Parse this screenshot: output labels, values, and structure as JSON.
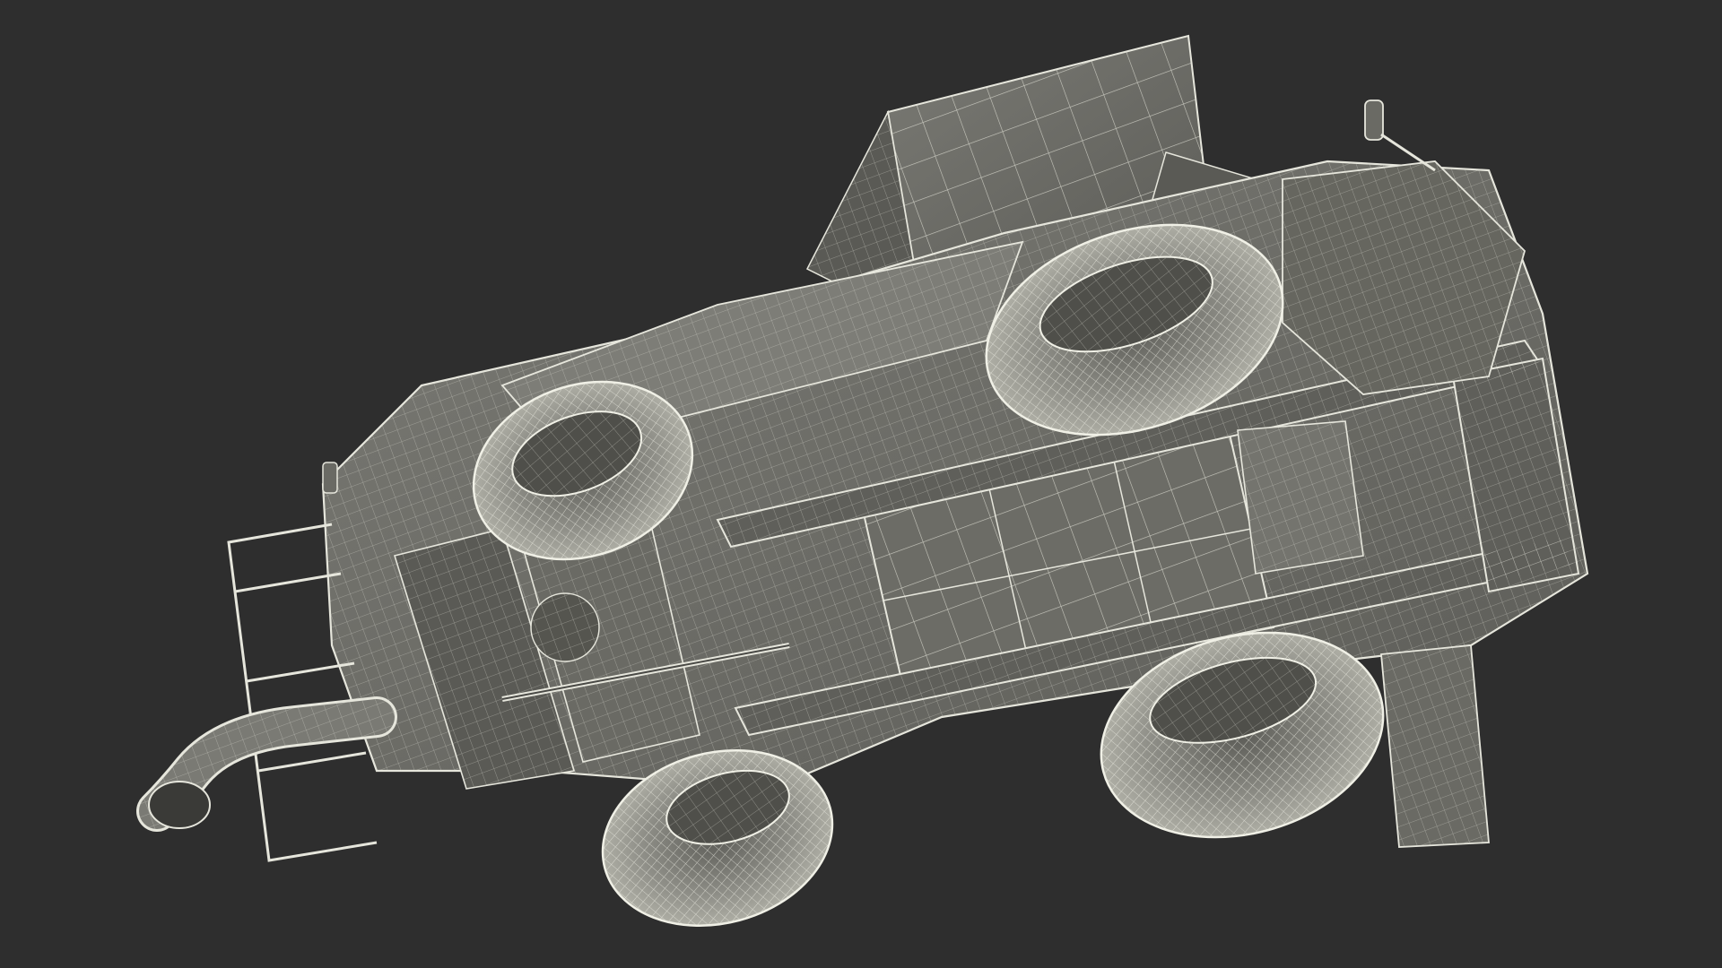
{
  "scene": {
    "subject": "wireframe-telehandler-underside",
    "colors": {
      "background": "#2e2e2e",
      "panel_fill": "#6f6f6a",
      "panel_light": "#86867f",
      "panel_dark": "#4a4a46",
      "wire": "#e6e6dc",
      "wire_soft": "#bdbdb2",
      "shadow": "#1f1f1f",
      "tire_fill": "#8a8a84"
    },
    "icons": {
      "front_wheel_left": "tire-icon",
      "front_wheel_right": "tire-icon",
      "rear_wheel_left": "tire-icon",
      "rear_wheel_right": "tire-icon",
      "exhaust": "exhaust-pipe-icon",
      "guard_frame": "guard-frame-icon",
      "fork_blade": "fork-blade-icon",
      "mirror": "mirror-icon"
    }
  }
}
